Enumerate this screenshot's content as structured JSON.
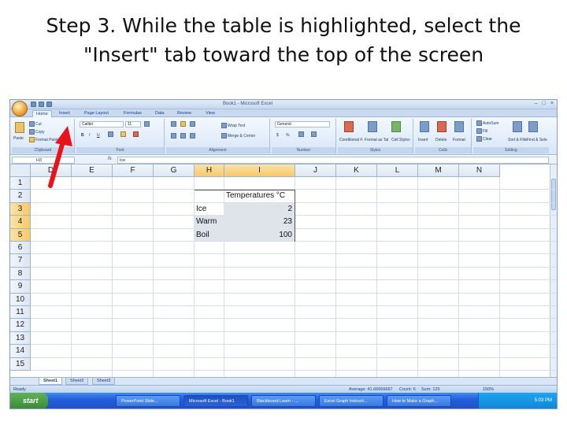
{
  "slide": {
    "title_line1": "Step 3. While the table is highlighted, select the",
    "title_line2": "\"Insert\" tab toward the top of the screen"
  },
  "window": {
    "title": "Book1 - Microsoft Excel",
    "controls": [
      "–",
      "□",
      "×"
    ]
  },
  "ribbon": {
    "tabs": [
      "Home",
      "Insert",
      "Page Layout",
      "Formulas",
      "Data",
      "Review",
      "View"
    ],
    "active_tab": "Home",
    "groups": {
      "clipboard": {
        "label": "Clipboard",
        "paste": "Paste",
        "cut": "Cut",
        "copy": "Copy",
        "format_painter": "Format Painter"
      },
      "font": {
        "label": "Font",
        "font_name": "Calibri",
        "font_size": "11",
        "bold": "B",
        "italic": "I",
        "underline": "U"
      },
      "alignment": {
        "label": "Alignment",
        "wrap_text": "Wrap Text",
        "merge_center": "Merge & Center"
      },
      "number": {
        "label": "Number",
        "format": "General",
        "currency": "$",
        "percent": "%"
      },
      "styles": {
        "label": "Styles",
        "conditional": "Conditional Formatting",
        "format_table": "Format as Table",
        "cell_styles": "Cell Styles"
      },
      "cells": {
        "label": "Cells",
        "insert": "Insert",
        "delete": "Delete",
        "format": "Format"
      },
      "editing": {
        "label": "Editing",
        "autosum": "AutoSum",
        "fill": "Fill",
        "clear": "Clear",
        "sort_filter": "Sort & Filter",
        "find_select": "Find & Select"
      }
    }
  },
  "formula_bar": {
    "name_box": "H3",
    "fx": "fx",
    "value": "Ice"
  },
  "grid": {
    "columns": [
      "D",
      "E",
      "F",
      "G",
      "H",
      "I",
      "J",
      "K",
      "L",
      "M",
      "N"
    ],
    "selected_columns": [
      "H",
      "I"
    ],
    "rows": [
      "1",
      "2",
      "3",
      "4",
      "5",
      "6",
      "7",
      "8",
      "9",
      "10",
      "11",
      "12",
      "13",
      "14",
      "15"
    ],
    "selected_rows": [
      "3",
      "4",
      "5"
    ],
    "table": {
      "header": "Temperatures °C",
      "rows": [
        {
          "label": "Ice",
          "value": "2"
        },
        {
          "label": "Warm",
          "value": "23"
        },
        {
          "label": "Boil",
          "value": "100"
        }
      ]
    }
  },
  "sheets": {
    "tabs": [
      "Sheet1",
      "Sheet2",
      "Sheet3"
    ],
    "active": "Sheet1"
  },
  "status": {
    "left": "Ready",
    "average": "Average: 41.66666667",
    "count": "Count: 6",
    "sum": "Sum: 125",
    "zoom": "150%"
  },
  "taskbar": {
    "start": "start",
    "items": [
      "PowerPoint Slide...",
      "Microsoft Excel - Book1",
      "Blackboard Learn - ...",
      "Excel Graph Instruct...",
      "How to Make a Graph..."
    ],
    "clock": "5:03 PM"
  },
  "annotation": {
    "arrow_color": "#e8141c"
  }
}
